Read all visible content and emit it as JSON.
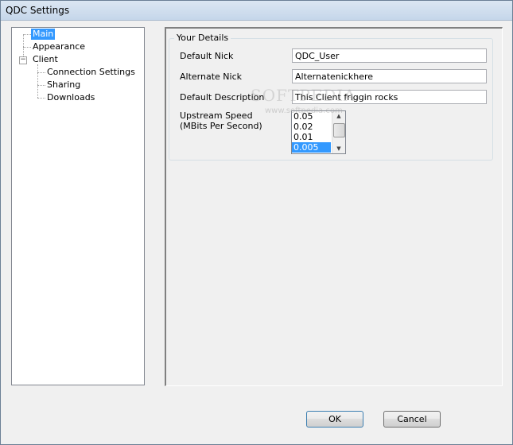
{
  "window": {
    "title": "QDC Settings"
  },
  "tree": {
    "items": [
      {
        "label": "Main",
        "selected": true
      },
      {
        "label": "Appearance"
      },
      {
        "label": "Client",
        "expander": "−"
      },
      {
        "label": "Connection Settings"
      },
      {
        "label": "Sharing"
      },
      {
        "label": "Downloads"
      }
    ]
  },
  "group": {
    "legend": "Your Details",
    "default_nick": {
      "label": "Default Nick",
      "value": "QDC_User"
    },
    "alternate_nick": {
      "label": "Alternate Nick",
      "value": "Alternatenickhere"
    },
    "default_description": {
      "label": "Default Description",
      "value": "This Client friggin rocks"
    },
    "upstream_speed": {
      "label_line1": "Upstream Speed",
      "label_line2": "(MBits Per Second)",
      "options": [
        "0.05",
        "0.02",
        "0.01",
        "0.005"
      ],
      "selected": "0.005"
    }
  },
  "watermark": {
    "text": "SOFTPEDIA",
    "small": "www.softpedia.com"
  },
  "buttons": {
    "ok": "OK",
    "cancel": "Cancel"
  },
  "colors": {
    "selection": "#3399ff",
    "titlebar": "#c5d6ea"
  }
}
